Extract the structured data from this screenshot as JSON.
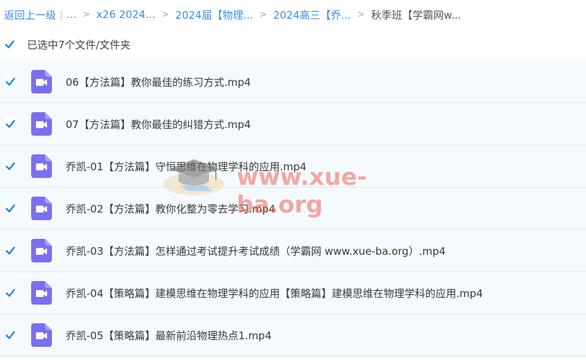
{
  "breadcrumb": {
    "back": "返回上一级",
    "more": "...",
    "items": [
      "x26 2024...",
      "2024届【物理...",
      "2024高三【乔...",
      "秋季班【学霸网w..."
    ]
  },
  "selection": {
    "label": "已选中7个文件/文件夹",
    "checked": true
  },
  "files": [
    {
      "name": "06【方法篇】教你最佳的练习方式.mp4",
      "icon": "video-file-icon",
      "checked": true
    },
    {
      "name": "07【方法篇】教你最佳的纠错方式.mp4",
      "icon": "video-file-icon",
      "checked": true
    },
    {
      "name": "乔凯-01【方法篇】守恒思维在物理学科的应用.mp4",
      "icon": "video-file-icon",
      "checked": true
    },
    {
      "name": "乔凯-02【方法篇】教你化整为零去学习.mp4",
      "icon": "video-file-icon",
      "checked": true
    },
    {
      "name": "乔凯-03【方法篇】怎样通过考试提升考试成绩（学霸网 www.xue-ba.org）.mp4",
      "icon": "video-file-icon",
      "checked": true
    },
    {
      "name": "乔凯-04【策略篇】建模思维在物理学科的应用【策略篇】建模思维在物理学科的应用.mp4",
      "icon": "video-file-icon",
      "checked": true
    },
    {
      "name": "乔凯-05【策略篇】最新前沿物理热点1.mp4",
      "icon": "video-file-icon",
      "checked": true
    }
  ],
  "watermark": {
    "text": "www.xue-ba.org"
  },
  "colors": {
    "accent": "#3a8ee6",
    "checkbox": "#1e88e5",
    "video_icon": "#7b6fef",
    "row_background": "#f4fafd"
  }
}
